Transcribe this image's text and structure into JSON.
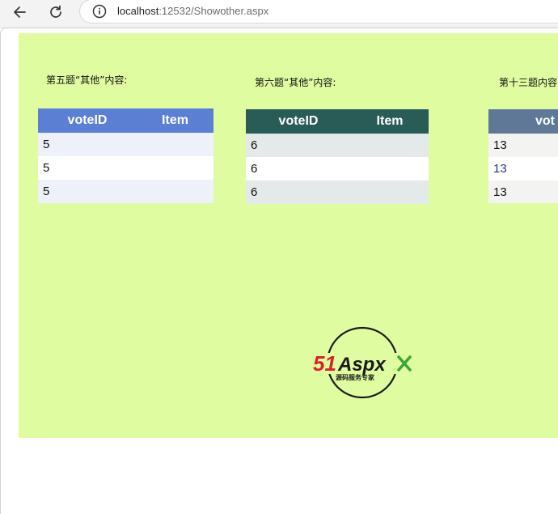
{
  "browser": {
    "url_host": "localhost",
    "url_rest": ":12532/Showother.aspx"
  },
  "sections": [
    {
      "caption": "第五题“其他”内容:",
      "headers": [
        "voteID",
        "Item"
      ],
      "rows": [
        [
          "5",
          ""
        ],
        [
          "5",
          ""
        ],
        [
          "5",
          ""
        ]
      ]
    },
    {
      "caption": "第六题“其他”内容:",
      "headers": [
        "voteID",
        "Item"
      ],
      "rows": [
        [
          "6",
          ""
        ],
        [
          "6",
          ""
        ],
        [
          "6",
          ""
        ]
      ]
    },
    {
      "caption": "第十三题内容",
      "headers": [
        "vot"
      ],
      "rows": [
        [
          "13"
        ],
        [
          "13"
        ],
        [
          "13"
        ]
      ]
    }
  ],
  "logo": {
    "brand_51": "51",
    "brand_aspx": "Aspx",
    "tagline": "源码服务专家"
  },
  "colors": {
    "panel_bg": "#e0fca0",
    "grid1_header": "#5b7fd3",
    "grid2_header": "#2a5c57",
    "grid3_header": "#5f7898"
  }
}
